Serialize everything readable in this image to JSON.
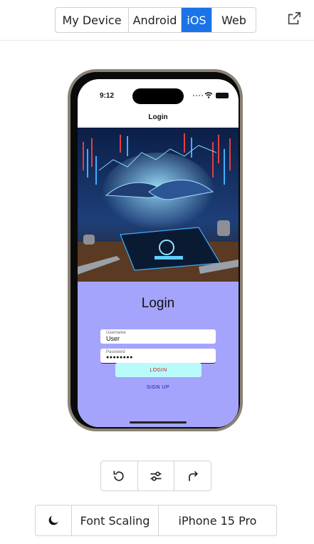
{
  "platform_tabs": [
    {
      "label": "My Device",
      "active": false
    },
    {
      "label": "Android",
      "active": false
    },
    {
      "label": "iOS",
      "active": true
    },
    {
      "label": "Web",
      "active": false
    }
  ],
  "toolbar_icons": {
    "external": "external-link-icon"
  },
  "device": {
    "status_time": "9:12",
    "nav_title": "Login",
    "login_heading": "Login",
    "username": {
      "label": "Username",
      "value": "User"
    },
    "password": {
      "label": "Password",
      "value": "●●●●●●●●"
    },
    "login_button": "LOGIN",
    "signup_button": "SIGN UP",
    "colors": {
      "login_bg": "#a5a4fd",
      "login_button_bg": "#b9fbfb",
      "login_button_text": "#c8161d",
      "signup_text": "#1a1a9c"
    }
  },
  "controls": {
    "rotate": "rotate-icon",
    "settings": "sliders-icon",
    "share": "redo-icon"
  },
  "bottom_bar": {
    "theme_icon": "moon-icon",
    "font_scaling": "Font Scaling",
    "device_name": "iPhone 15 Pro"
  },
  "accent": "#1a73e8"
}
